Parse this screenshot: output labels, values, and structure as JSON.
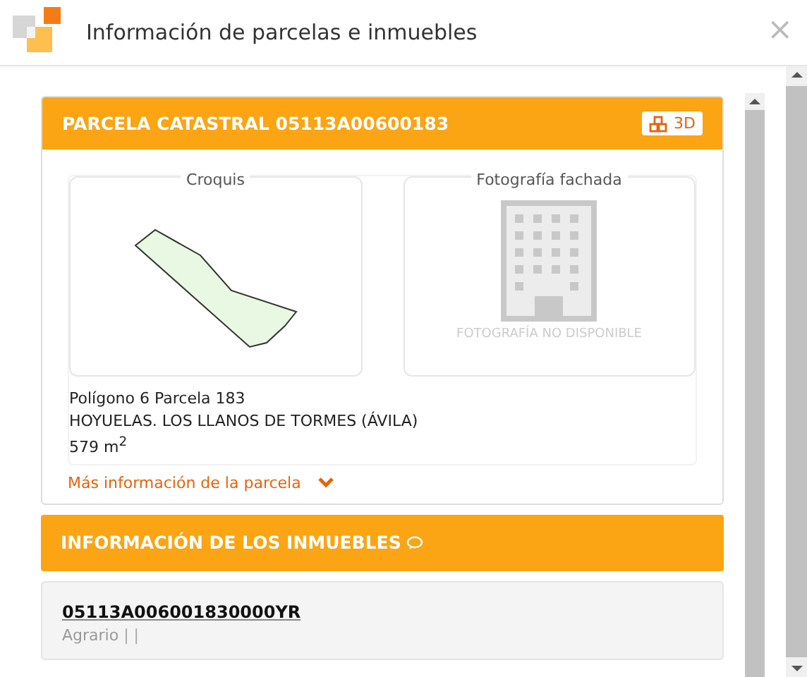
{
  "window": {
    "title": "Información de parcelas e inmuebles",
    "close": "×"
  },
  "parcel": {
    "title": "PARCELA CATASTRAL 05113A00600183",
    "button_3d": "3D",
    "sketch_label": "Croquis",
    "photo_label": "Fotografía fachada",
    "photo_unavailable": "FOTOGRAFÍA NO DISPONIBLE",
    "lines": [
      "Polígono 6 Parcela 183",
      "HOYUELAS. LOS LLANOS DE TORMES (ÁVILA)",
      "579 m$^{2}$"
    ],
    "more_link": "Más información de la parcela",
    "expanded": false
  },
  "buildings": {
    "title": "INFORMACIÓN DE LOS INMUEBLES",
    "items": [
      {
        "reference": "05113A006001830000YR",
        "usage": "Agrario",
        "separators": "| |"
      }
    ]
  }
}
